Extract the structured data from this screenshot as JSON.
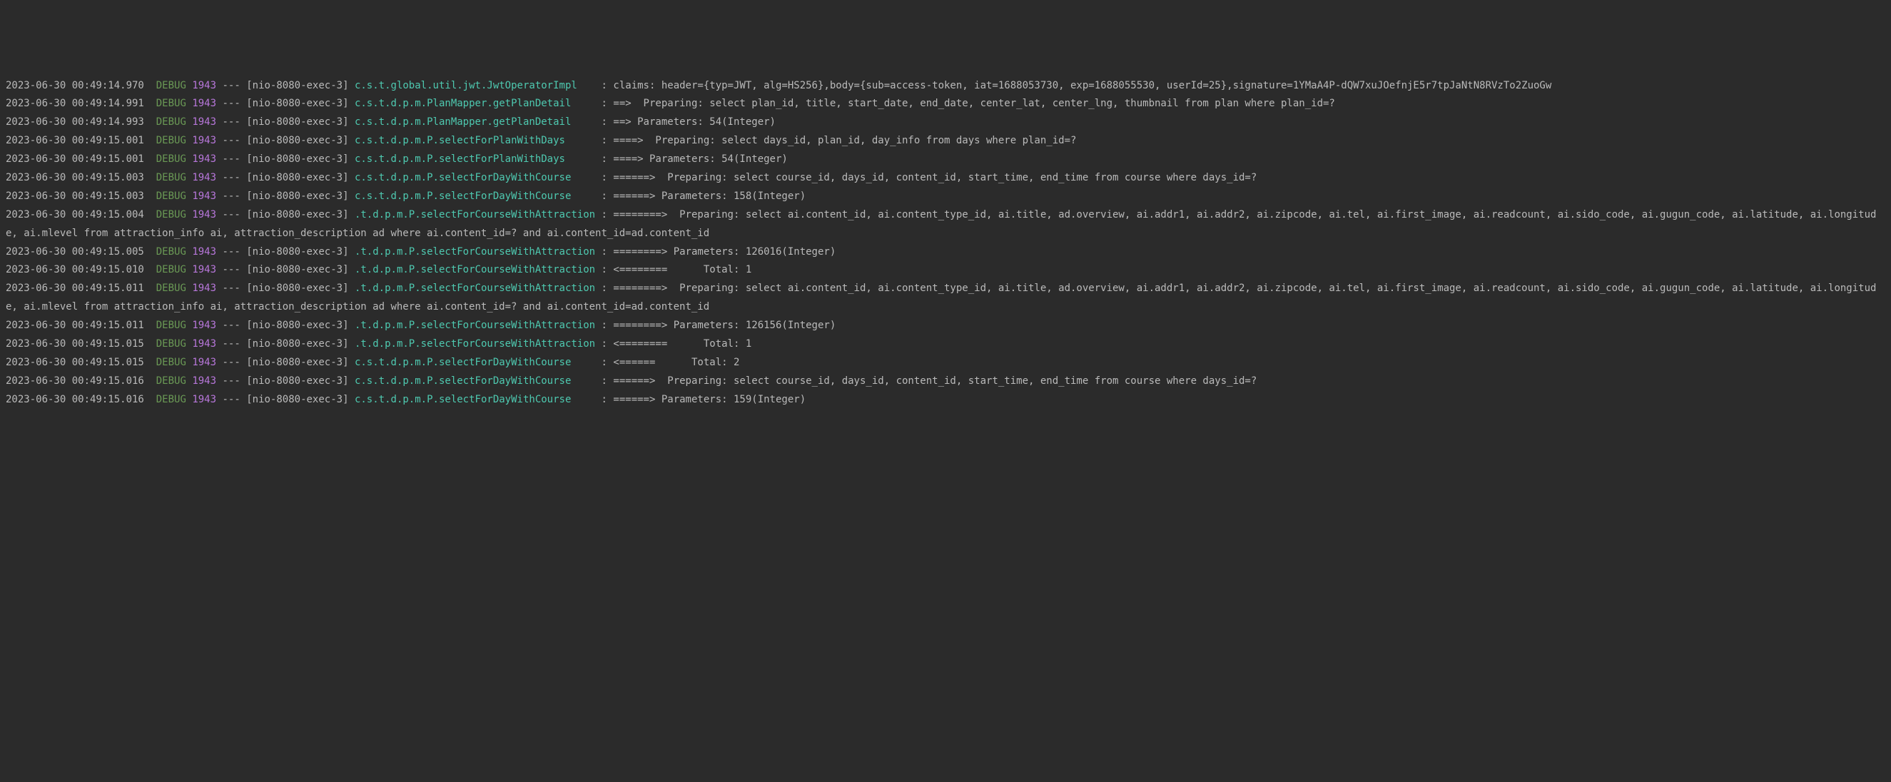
{
  "entries": [
    {
      "timestamp": "2023-06-30 00:49:14.970",
      "level": "DEBUG",
      "pid": "1943",
      "dashes": "---",
      "thread": "[nio-8080-exec-3]",
      "logger": "c.s.t.global.util.jwt.JwtOperatorImpl   ",
      "message": " claims: header={typ=JWT, alg=HS256},body={sub=access-token, iat=1688053730, exp=1688055530, userId=25},signature=1YMaA4P-dQW7xuJOefnjE5r7tpJaNtN8RVzTo2ZuoGw"
    },
    {
      "timestamp": "2023-06-30 00:49:14.991",
      "level": "DEBUG",
      "pid": "1943",
      "dashes": "---",
      "thread": "[nio-8080-exec-3]",
      "logger": "c.s.t.d.p.m.PlanMapper.getPlanDetail    ",
      "message": " ==>  Preparing: select plan_id, title, start_date, end_date, center_lat, center_lng, thumbnail from plan where plan_id=?"
    },
    {
      "timestamp": "2023-06-30 00:49:14.993",
      "level": "DEBUG",
      "pid": "1943",
      "dashes": "---",
      "thread": "[nio-8080-exec-3]",
      "logger": "c.s.t.d.p.m.PlanMapper.getPlanDetail    ",
      "message": " ==> Parameters: 54(Integer)"
    },
    {
      "timestamp": "2023-06-30 00:49:15.001",
      "level": "DEBUG",
      "pid": "1943",
      "dashes": "---",
      "thread": "[nio-8080-exec-3]",
      "logger": "c.s.t.d.p.m.P.selectForPlanWithDays     ",
      "message": " ====>  Preparing: select days_id, plan_id, day_info from days where plan_id=?"
    },
    {
      "timestamp": "2023-06-30 00:49:15.001",
      "level": "DEBUG",
      "pid": "1943",
      "dashes": "---",
      "thread": "[nio-8080-exec-3]",
      "logger": "c.s.t.d.p.m.P.selectForPlanWithDays     ",
      "message": " ====> Parameters: 54(Integer)"
    },
    {
      "timestamp": "2023-06-30 00:49:15.003",
      "level": "DEBUG",
      "pid": "1943",
      "dashes": "---",
      "thread": "[nio-8080-exec-3]",
      "logger": "c.s.t.d.p.m.P.selectForDayWithCourse    ",
      "message": " ======>  Preparing: select course_id, days_id, content_id, start_time, end_time from course where days_id=?"
    },
    {
      "timestamp": "2023-06-30 00:49:15.003",
      "level": "DEBUG",
      "pid": "1943",
      "dashes": "---",
      "thread": "[nio-8080-exec-3]",
      "logger": "c.s.t.d.p.m.P.selectForDayWithCourse    ",
      "message": " ======> Parameters: 158(Integer)"
    },
    {
      "timestamp": "2023-06-30 00:49:15.004",
      "level": "DEBUG",
      "pid": "1943",
      "dashes": "---",
      "thread": "[nio-8080-exec-3]",
      "logger": ".t.d.p.m.P.selectForCourseWithAttraction",
      "message": " ========>  Preparing: select ai.content_id, ai.content_type_id, ai.title, ad.overview, ai.addr1, ai.addr2, ai.zipcode, ai.tel, ai.first_image, ai.readcount, ai.sido_code, ai.gugun_code, ai.latitude, ai.longitude, ai.mlevel from attraction_info ai, attraction_description ad where ai.content_id=? and ai.content_id=ad.content_id"
    },
    {
      "timestamp": "2023-06-30 00:49:15.005",
      "level": "DEBUG",
      "pid": "1943",
      "dashes": "---",
      "thread": "[nio-8080-exec-3]",
      "logger": ".t.d.p.m.P.selectForCourseWithAttraction",
      "message": " ========> Parameters: 126016(Integer)"
    },
    {
      "timestamp": "2023-06-30 00:49:15.010",
      "level": "DEBUG",
      "pid": "1943",
      "dashes": "---",
      "thread": "[nio-8080-exec-3]",
      "logger": ".t.d.p.m.P.selectForCourseWithAttraction",
      "message": " <========      Total: 1"
    },
    {
      "timestamp": "2023-06-30 00:49:15.011",
      "level": "DEBUG",
      "pid": "1943",
      "dashes": "---",
      "thread": "[nio-8080-exec-3]",
      "logger": ".t.d.p.m.P.selectForCourseWithAttraction",
      "message": " ========>  Preparing: select ai.content_id, ai.content_type_id, ai.title, ad.overview, ai.addr1, ai.addr2, ai.zipcode, ai.tel, ai.first_image, ai.readcount, ai.sido_code, ai.gugun_code, ai.latitude, ai.longitude, ai.mlevel from attraction_info ai, attraction_description ad where ai.content_id=? and ai.content_id=ad.content_id"
    },
    {
      "timestamp": "2023-06-30 00:49:15.011",
      "level": "DEBUG",
      "pid": "1943",
      "dashes": "---",
      "thread": "[nio-8080-exec-3]",
      "logger": ".t.d.p.m.P.selectForCourseWithAttraction",
      "message": " ========> Parameters: 126156(Integer)"
    },
    {
      "timestamp": "2023-06-30 00:49:15.015",
      "level": "DEBUG",
      "pid": "1943",
      "dashes": "---",
      "thread": "[nio-8080-exec-3]",
      "logger": ".t.d.p.m.P.selectForCourseWithAttraction",
      "message": " <========      Total: 1"
    },
    {
      "timestamp": "2023-06-30 00:49:15.015",
      "level": "DEBUG",
      "pid": "1943",
      "dashes": "---",
      "thread": "[nio-8080-exec-3]",
      "logger": "c.s.t.d.p.m.P.selectForDayWithCourse    ",
      "message": " <======      Total: 2"
    },
    {
      "timestamp": "2023-06-30 00:49:15.016",
      "level": "DEBUG",
      "pid": "1943",
      "dashes": "---",
      "thread": "[nio-8080-exec-3]",
      "logger": "c.s.t.d.p.m.P.selectForDayWithCourse    ",
      "message": " ======>  Preparing: select course_id, days_id, content_id, start_time, end_time from course where days_id=?"
    },
    {
      "timestamp": "2023-06-30 00:49:15.016",
      "level": "DEBUG",
      "pid": "1943",
      "dashes": "---",
      "thread": "[nio-8080-exec-3]",
      "logger": "c.s.t.d.p.m.P.selectForDayWithCourse    ",
      "message": " ======> Parameters: 159(Integer)"
    }
  ]
}
